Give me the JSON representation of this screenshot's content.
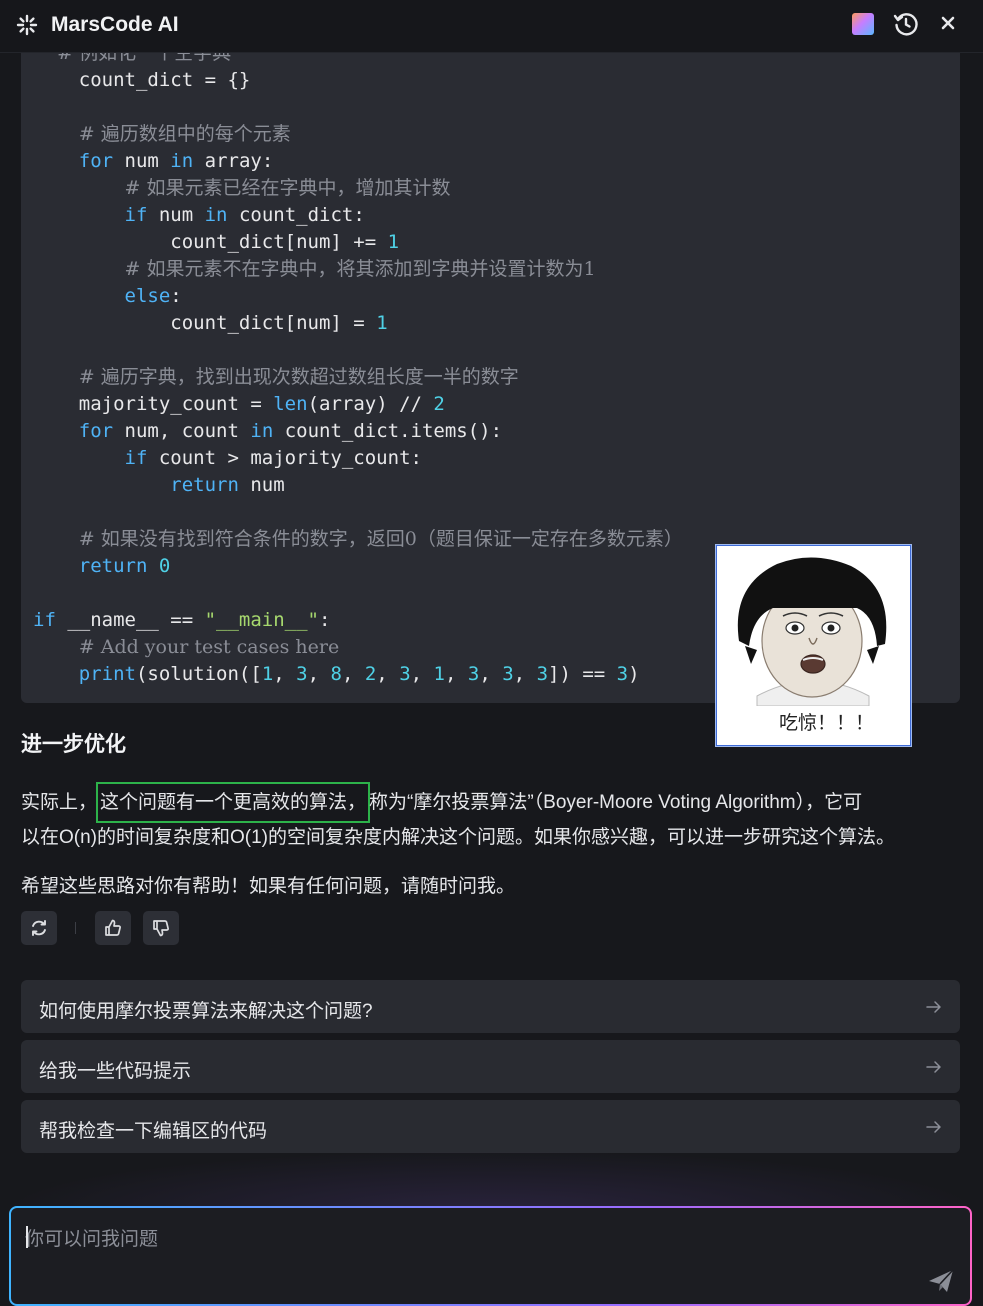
{
  "header": {
    "title": "MarsCode AI",
    "icons": [
      "marscode-logo-icon",
      "avatar",
      "history-icon",
      "close-icon"
    ]
  },
  "code": {
    "lines": [
      {
        "indent": "    ",
        "tokens": [
          {
            "t": "count_dict = {}",
            "c": ""
          }
        ]
      },
      {
        "indent": "",
        "tokens": []
      },
      {
        "indent": "    ",
        "tokens": [
          {
            "t": "# 遍历数组中的每个元素",
            "c": "cm"
          }
        ]
      },
      {
        "indent": "    ",
        "tokens": [
          {
            "t": "for",
            "c": "kw"
          },
          {
            "t": " num ",
            "c": ""
          },
          {
            "t": "in",
            "c": "kw"
          },
          {
            "t": " array:",
            "c": ""
          }
        ]
      },
      {
        "indent": "        ",
        "tokens": [
          {
            "t": "# 如果元素已经在字典中，增加其计数",
            "c": "cm"
          }
        ]
      },
      {
        "indent": "        ",
        "tokens": [
          {
            "t": "if",
            "c": "kw"
          },
          {
            "t": " num ",
            "c": ""
          },
          {
            "t": "in",
            "c": "kw"
          },
          {
            "t": " count_dict:",
            "c": ""
          }
        ]
      },
      {
        "indent": "            ",
        "tokens": [
          {
            "t": "count_dict[num] += ",
            "c": ""
          },
          {
            "t": "1",
            "c": "num"
          }
        ]
      },
      {
        "indent": "        ",
        "tokens": [
          {
            "t": "# 如果元素不在字典中，将其添加到字典并设置计数为1",
            "c": "cm"
          }
        ]
      },
      {
        "indent": "        ",
        "tokens": [
          {
            "t": "else",
            "c": "kw"
          },
          {
            "t": ":",
            "c": ""
          }
        ]
      },
      {
        "indent": "            ",
        "tokens": [
          {
            "t": "count_dict[num] = ",
            "c": ""
          },
          {
            "t": "1",
            "c": "num"
          }
        ]
      },
      {
        "indent": "",
        "tokens": []
      },
      {
        "indent": "    ",
        "tokens": [
          {
            "t": "# 遍历字典，找到出现次数超过数组长度一半的数字",
            "c": "cm"
          }
        ]
      },
      {
        "indent": "    ",
        "tokens": [
          {
            "t": "majority_count = ",
            "c": ""
          },
          {
            "t": "len",
            "c": "kw"
          },
          {
            "t": "(array) // ",
            "c": ""
          },
          {
            "t": "2",
            "c": "num"
          }
        ]
      },
      {
        "indent": "    ",
        "tokens": [
          {
            "t": "for",
            "c": "kw"
          },
          {
            "t": " num, count ",
            "c": ""
          },
          {
            "t": "in",
            "c": "kw"
          },
          {
            "t": " count_dict.items():",
            "c": ""
          }
        ]
      },
      {
        "indent": "        ",
        "tokens": [
          {
            "t": "if",
            "c": "kw"
          },
          {
            "t": " count > majority_count:",
            "c": ""
          }
        ]
      },
      {
        "indent": "            ",
        "tokens": [
          {
            "t": "return",
            "c": "kw"
          },
          {
            "t": " num",
            "c": ""
          }
        ]
      },
      {
        "indent": "",
        "tokens": []
      },
      {
        "indent": "    ",
        "tokens": [
          {
            "t": "# 如果没有找到符合条件的数字，返回0（题目保证一定存在多数元素）",
            "c": "cm"
          }
        ]
      },
      {
        "indent": "    ",
        "tokens": [
          {
            "t": "return",
            "c": "kw"
          },
          {
            "t": " ",
            "c": ""
          },
          {
            "t": "0",
            "c": "num"
          }
        ]
      },
      {
        "indent": "",
        "tokens": []
      },
      {
        "indent": "",
        "tokens": [
          {
            "t": "if",
            "c": "kw"
          },
          {
            "t": " __name__ == ",
            "c": ""
          },
          {
            "t": "\"__main__\"",
            "c": "str"
          },
          {
            "t": ":",
            "c": ""
          }
        ]
      },
      {
        "indent": "    ",
        "tokens": [
          {
            "t": "# Add your test cases here",
            "c": "cm"
          }
        ]
      },
      {
        "indent": "    ",
        "tokens": [
          {
            "t": "print",
            "c": "kw"
          },
          {
            "t": "(solution([",
            "c": ""
          },
          {
            "t": "1",
            "c": "num"
          },
          {
            "t": ", ",
            "c": ""
          },
          {
            "t": "3",
            "c": "num"
          },
          {
            "t": ", ",
            "c": ""
          },
          {
            "t": "8",
            "c": "num"
          },
          {
            "t": ", ",
            "c": ""
          },
          {
            "t": "2",
            "c": "num"
          },
          {
            "t": ", ",
            "c": ""
          },
          {
            "t": "3",
            "c": "num"
          },
          {
            "t": ", ",
            "c": ""
          },
          {
            "t": "1",
            "c": "num"
          },
          {
            "t": ", ",
            "c": ""
          },
          {
            "t": "3",
            "c": "num"
          },
          {
            "t": ", ",
            "c": ""
          },
          {
            "t": "3",
            "c": "num"
          },
          {
            "t": ", ",
            "c": ""
          },
          {
            "t": "3",
            "c": "num"
          },
          {
            "t": "]) == ",
            "c": ""
          },
          {
            "t": "3",
            "c": "num"
          },
          {
            "t": ")",
            "c": ""
          }
        ]
      }
    ]
  },
  "sticker": {
    "caption": "吃惊！！！"
  },
  "section": {
    "heading": "进一步优化",
    "para1_prefix": "实际上，",
    "para1_highlight": "这个问题有一个更高效的算法，",
    "para1_suffix": "称为“摩尔投票算法”（Boyer-Moore Voting Algorithm），它可",
    "para1_line2": "以在O(n)的时间复杂度和O(1)的空间复杂度内解决这个问题。如果你感兴趣，可以进一步研究这个算法。",
    "para2": "希望这些思路对你有帮助！如果有任何问题，请随时问我。"
  },
  "suggestions": [
    {
      "label": "如何使用摩尔投票算法来解决这个问题?"
    },
    {
      "label": "给我一些代码提示"
    },
    {
      "label": "帮我检查一下编辑区的代码"
    }
  ],
  "input": {
    "placeholder": "你可以问我问题"
  },
  "colors": {
    "keyword": "#4fb3f6",
    "number": "#4fd1e6",
    "string": "#a6d86e",
    "comment": "#8a8d96",
    "highlight_box": "#2db24a"
  }
}
